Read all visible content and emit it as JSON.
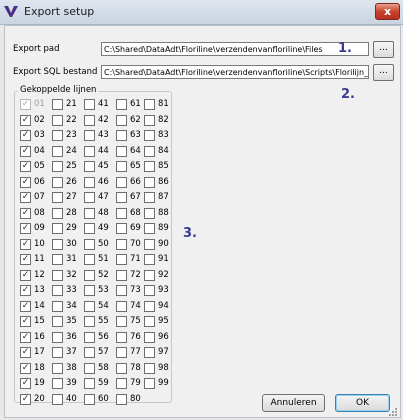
{
  "window": {
    "title": "Export setup",
    "close_label": "x"
  },
  "form": {
    "export_pad": {
      "label": "Export pad",
      "value": "C:\\Shared\\DataAdt\\Floriline\\verzendenvanfloriline\\Files"
    },
    "export_sql": {
      "label": "Export SQL bestand",
      "value": "C:\\Shared\\DataAdt\\Floriline\\verzendenvanfloriline\\Scripts\\Florilijn_"
    },
    "browse_label": "..."
  },
  "markers": [
    "1.",
    "2.",
    "3."
  ],
  "lines_group": {
    "title": "Gekoppelde lijnen",
    "check_mark": "✓",
    "columns": [
      [
        {
          "num": "01",
          "checked": true,
          "disabled": true
        },
        {
          "num": "02",
          "checked": true
        },
        {
          "num": "03",
          "checked": true
        },
        {
          "num": "04",
          "checked": true
        },
        {
          "num": "05",
          "checked": true
        },
        {
          "num": "06",
          "checked": true
        },
        {
          "num": "07",
          "checked": true
        },
        {
          "num": "08",
          "checked": true
        },
        {
          "num": "09",
          "checked": true
        },
        {
          "num": "10",
          "checked": true
        },
        {
          "num": "11",
          "checked": true
        },
        {
          "num": "12",
          "checked": true
        },
        {
          "num": "13",
          "checked": true
        },
        {
          "num": "14",
          "checked": true
        },
        {
          "num": "15",
          "checked": true
        },
        {
          "num": "16",
          "checked": true
        },
        {
          "num": "17",
          "checked": true
        },
        {
          "num": "18",
          "checked": true
        },
        {
          "num": "19",
          "checked": true
        },
        {
          "num": "20",
          "checked": true
        }
      ],
      [
        {
          "num": "21",
          "checked": false
        },
        {
          "num": "22",
          "checked": false
        },
        {
          "num": "23",
          "checked": false
        },
        {
          "num": "24",
          "checked": false
        },
        {
          "num": "25",
          "checked": false
        },
        {
          "num": "26",
          "checked": false
        },
        {
          "num": "27",
          "checked": false
        },
        {
          "num": "28",
          "checked": false
        },
        {
          "num": "29",
          "checked": false
        },
        {
          "num": "30",
          "checked": false
        },
        {
          "num": "31",
          "checked": false
        },
        {
          "num": "32",
          "checked": false
        },
        {
          "num": "33",
          "checked": false
        },
        {
          "num": "34",
          "checked": false
        },
        {
          "num": "35",
          "checked": false
        },
        {
          "num": "36",
          "checked": false
        },
        {
          "num": "37",
          "checked": false
        },
        {
          "num": "38",
          "checked": false
        },
        {
          "num": "39",
          "checked": false
        },
        {
          "num": "40",
          "checked": false
        }
      ],
      [
        {
          "num": "41",
          "checked": false
        },
        {
          "num": "42",
          "checked": false
        },
        {
          "num": "43",
          "checked": false
        },
        {
          "num": "44",
          "checked": false
        },
        {
          "num": "45",
          "checked": false
        },
        {
          "num": "46",
          "checked": false
        },
        {
          "num": "47",
          "checked": false
        },
        {
          "num": "48",
          "checked": false
        },
        {
          "num": "49",
          "checked": false
        },
        {
          "num": "50",
          "checked": false
        },
        {
          "num": "51",
          "checked": false
        },
        {
          "num": "52",
          "checked": false
        },
        {
          "num": "53",
          "checked": false
        },
        {
          "num": "54",
          "checked": false
        },
        {
          "num": "55",
          "checked": false
        },
        {
          "num": "56",
          "checked": false
        },
        {
          "num": "57",
          "checked": false
        },
        {
          "num": "58",
          "checked": false
        },
        {
          "num": "59",
          "checked": false
        },
        {
          "num": "60",
          "checked": false
        }
      ],
      [
        {
          "num": "61",
          "checked": false
        },
        {
          "num": "62",
          "checked": false
        },
        {
          "num": "63",
          "checked": false
        },
        {
          "num": "64",
          "checked": false
        },
        {
          "num": "65",
          "checked": false
        },
        {
          "num": "66",
          "checked": false
        },
        {
          "num": "67",
          "checked": false
        },
        {
          "num": "68",
          "checked": false
        },
        {
          "num": "69",
          "checked": false
        },
        {
          "num": "70",
          "checked": false
        },
        {
          "num": "71",
          "checked": false
        },
        {
          "num": "72",
          "checked": false
        },
        {
          "num": "73",
          "checked": false
        },
        {
          "num": "74",
          "checked": false
        },
        {
          "num": "75",
          "checked": false
        },
        {
          "num": "76",
          "checked": false
        },
        {
          "num": "77",
          "checked": false
        },
        {
          "num": "78",
          "checked": false
        },
        {
          "num": "79",
          "checked": false
        },
        {
          "num": "80",
          "checked": false
        }
      ],
      [
        {
          "num": "81",
          "checked": false
        },
        {
          "num": "82",
          "checked": false
        },
        {
          "num": "83",
          "checked": false
        },
        {
          "num": "84",
          "checked": false
        },
        {
          "num": "85",
          "checked": false
        },
        {
          "num": "86",
          "checked": false
        },
        {
          "num": "87",
          "checked": false
        },
        {
          "num": "88",
          "checked": false
        },
        {
          "num": "89",
          "checked": false
        },
        {
          "num": "90",
          "checked": false
        },
        {
          "num": "91",
          "checked": false
        },
        {
          "num": "92",
          "checked": false
        },
        {
          "num": "93",
          "checked": false
        },
        {
          "num": "94",
          "checked": false
        },
        {
          "num": "95",
          "checked": false
        },
        {
          "num": "96",
          "checked": false
        },
        {
          "num": "97",
          "checked": false
        },
        {
          "num": "98",
          "checked": false
        },
        {
          "num": "99",
          "checked": false
        }
      ]
    ]
  },
  "buttons": {
    "cancel": "Annuleren",
    "ok": "OK"
  },
  "colors": {
    "app_icon": "#4a2f86",
    "marker": "#3b3b8f",
    "close": "#c9432c"
  },
  "icons": {
    "app": "app-logo-icon",
    "close": "close-icon",
    "grip": "resize-grip-icon"
  }
}
